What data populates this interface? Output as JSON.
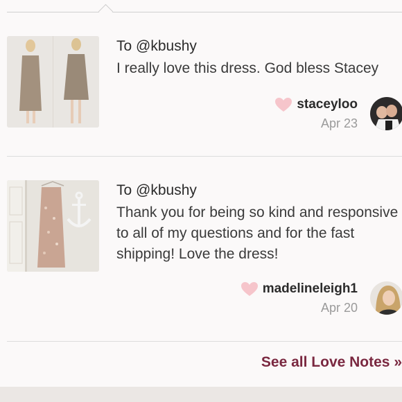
{
  "notes": [
    {
      "to": "To @kbushy",
      "message": "I really love this dress. God bless Stacey",
      "sender": "staceyloo",
      "date": "Apr 23",
      "thumbnail_icon": "dress-photo-thumbnail",
      "avatar_icon": "user-avatar"
    },
    {
      "to": "To @kbushy",
      "message": "Thank you for being so kind and responsive to all of my questions and for the fast shipping! Love the dress!",
      "sender": "madelineleigh1",
      "date": "Apr 20",
      "thumbnail_icon": "dress-photo-thumbnail",
      "avatar_icon": "user-avatar"
    }
  ],
  "footer": {
    "see_all_label": "See all Love Notes »"
  },
  "colors": {
    "heart": "#f6c5cb",
    "link": "#7a2840",
    "date": "#9a9a9a"
  }
}
